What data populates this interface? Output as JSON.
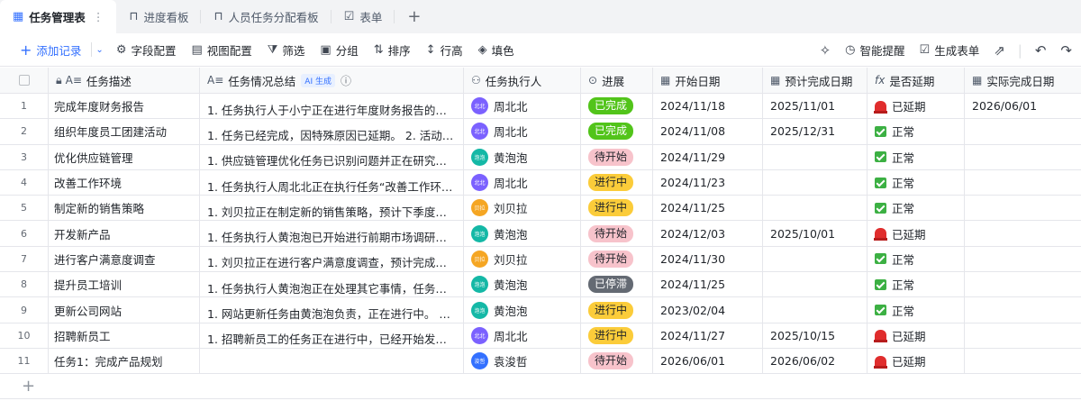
{
  "tabs": [
    {
      "label": "任务管理表",
      "icon": "table-icon",
      "active": true
    },
    {
      "label": "进度看板",
      "icon": "kanban-icon",
      "active": false
    },
    {
      "label": "人员任务分配看板",
      "icon": "kanban-icon",
      "active": false
    },
    {
      "label": "表单",
      "icon": "form-icon",
      "active": false
    }
  ],
  "toolbar": {
    "add_record": "添加记录",
    "field_config": "字段配置",
    "view_config": "视图配置",
    "filter": "筛选",
    "group": "分组",
    "sort": "排序",
    "row_height": "行高",
    "fill": "填色",
    "smart_alert": "智能提醒",
    "gen_form": "生成表单"
  },
  "columns": {
    "task_desc": "任务描述",
    "task_summary": "任务情况总结",
    "ai_badge": "AI 生成",
    "assignee": "任务执行人",
    "progress": "进展",
    "start_date": "开始日期",
    "planned_date": "预计完成日期",
    "is_delayed": "是否延期",
    "actual_date": "实际完成日期"
  },
  "colors": {
    "accent": "#3370ff",
    "done": "#52c41a",
    "pending": "#f7c3cb",
    "in_progress": "#fbcc3a",
    "stalled": "#646a73"
  },
  "rows": [
    {
      "no": "1",
      "desc": "完成年度财务报告",
      "summary": "1. 任务执行人于小宁正在进行年度财务报告的制作...",
      "avatar": "北北",
      "avatar_color": "#7b61ff",
      "assignee": "周北北",
      "status": "已完成",
      "status_kind": "done",
      "start": "2024/11/18",
      "planned": "2025/11/01",
      "delay": "已延期",
      "delay_kind": "late",
      "actual": "2026/06/01"
    },
    {
      "no": "2",
      "desc": "组织年度员工团建活动",
      "summary": "1. 任务已经完成，因特殊原因已延期。 2. 活动已...",
      "avatar": "北北",
      "avatar_color": "#7b61ff",
      "assignee": "周北北",
      "status": "已完成",
      "status_kind": "done",
      "start": "2024/11/08",
      "planned": "2025/12/31",
      "delay": "正常",
      "delay_kind": "ok",
      "actual": ""
    },
    {
      "no": "3",
      "desc": "优化供应链管理",
      "summary": "1. 供应链管理优化任务已识别问题并正在研究解决...",
      "avatar": "泡泡",
      "avatar_color": "#14b8a6",
      "assignee": "黄泡泡",
      "status": "待开始",
      "status_kind": "pending",
      "start": "2024/11/29",
      "planned": "",
      "delay": "正常",
      "delay_kind": "ok",
      "actual": ""
    },
    {
      "no": "4",
      "desc": "改善工作环境",
      "summary": "1. 任务执行人周北北正在执行任务“改善工作环境...",
      "avatar": "北北",
      "avatar_color": "#7b61ff",
      "assignee": "周北北",
      "status": "进行中",
      "status_kind": "progress",
      "start": "2024/11/23",
      "planned": "",
      "delay": "正常",
      "delay_kind": "ok",
      "actual": ""
    },
    {
      "no": "5",
      "desc": "制定新的销售策略",
      "summary": "1. 刘贝拉正在制定新的销售策略，预计下季度开始...",
      "avatar": "贝拉",
      "avatar_color": "#f5a623",
      "assignee": "刘贝拉",
      "status": "进行中",
      "status_kind": "progress",
      "start": "2024/11/25",
      "planned": "",
      "delay": "正常",
      "delay_kind": "ok",
      "actual": ""
    },
    {
      "no": "6",
      "desc": "开发新产品",
      "summary": "1. 任务执行人黄泡泡已开始进行前期市场调研和...",
      "avatar": "泡泡",
      "avatar_color": "#14b8a6",
      "assignee": "黄泡泡",
      "status": "待开始",
      "status_kind": "pending",
      "start": "2024/12/03",
      "planned": "2025/10/01",
      "delay": "已延期",
      "delay_kind": "late",
      "actual": ""
    },
    {
      "no": "7",
      "desc": "进行客户满意度调查",
      "summary": "1. 刘贝拉正在进行客户满意度调查，预计完成日...",
      "avatar": "贝拉",
      "avatar_color": "#f5a623",
      "assignee": "刘贝拉",
      "status": "待开始",
      "status_kind": "pending",
      "start": "2024/11/30",
      "planned": "",
      "delay": "正常",
      "delay_kind": "ok",
      "actual": ""
    },
    {
      "no": "8",
      "desc": "提升员工培训",
      "summary": "1. 任务执行人黄泡泡正在处理其它事情，任务已...",
      "avatar": "泡泡",
      "avatar_color": "#14b8a6",
      "assignee": "黄泡泡",
      "status": "已停滞",
      "status_kind": "stalled",
      "start": "2024/11/25",
      "planned": "",
      "delay": "正常",
      "delay_kind": "ok",
      "actual": ""
    },
    {
      "no": "9",
      "desc": "更新公司网站",
      "summary": "1. 网站更新任务由黄泡泡负责，正在进行中。 2. ...",
      "avatar": "泡泡",
      "avatar_color": "#14b8a6",
      "assignee": "黄泡泡",
      "status": "进行中",
      "status_kind": "progress",
      "start": "2023/02/04",
      "planned": "",
      "delay": "正常",
      "delay_kind": "ok",
      "actual": ""
    },
    {
      "no": "10",
      "desc": "招聘新员工",
      "summary": "1. 招聘新员工的任务正在进行中，已经开始发布...",
      "avatar": "北北",
      "avatar_color": "#7b61ff",
      "assignee": "周北北",
      "status": "进行中",
      "status_kind": "progress",
      "start": "2024/11/27",
      "planned": "2025/10/15",
      "delay": "已延期",
      "delay_kind": "late",
      "actual": ""
    },
    {
      "no": "11",
      "desc": "任务1：完成产品规划",
      "summary": "",
      "avatar": "浚哲",
      "avatar_color": "#3370ff",
      "assignee": "袁浚哲",
      "status": "待开始",
      "status_kind": "pending",
      "start": "2026/06/01",
      "planned": "2026/06/02",
      "delay": "已延期",
      "delay_kind": "late",
      "actual": ""
    }
  ]
}
